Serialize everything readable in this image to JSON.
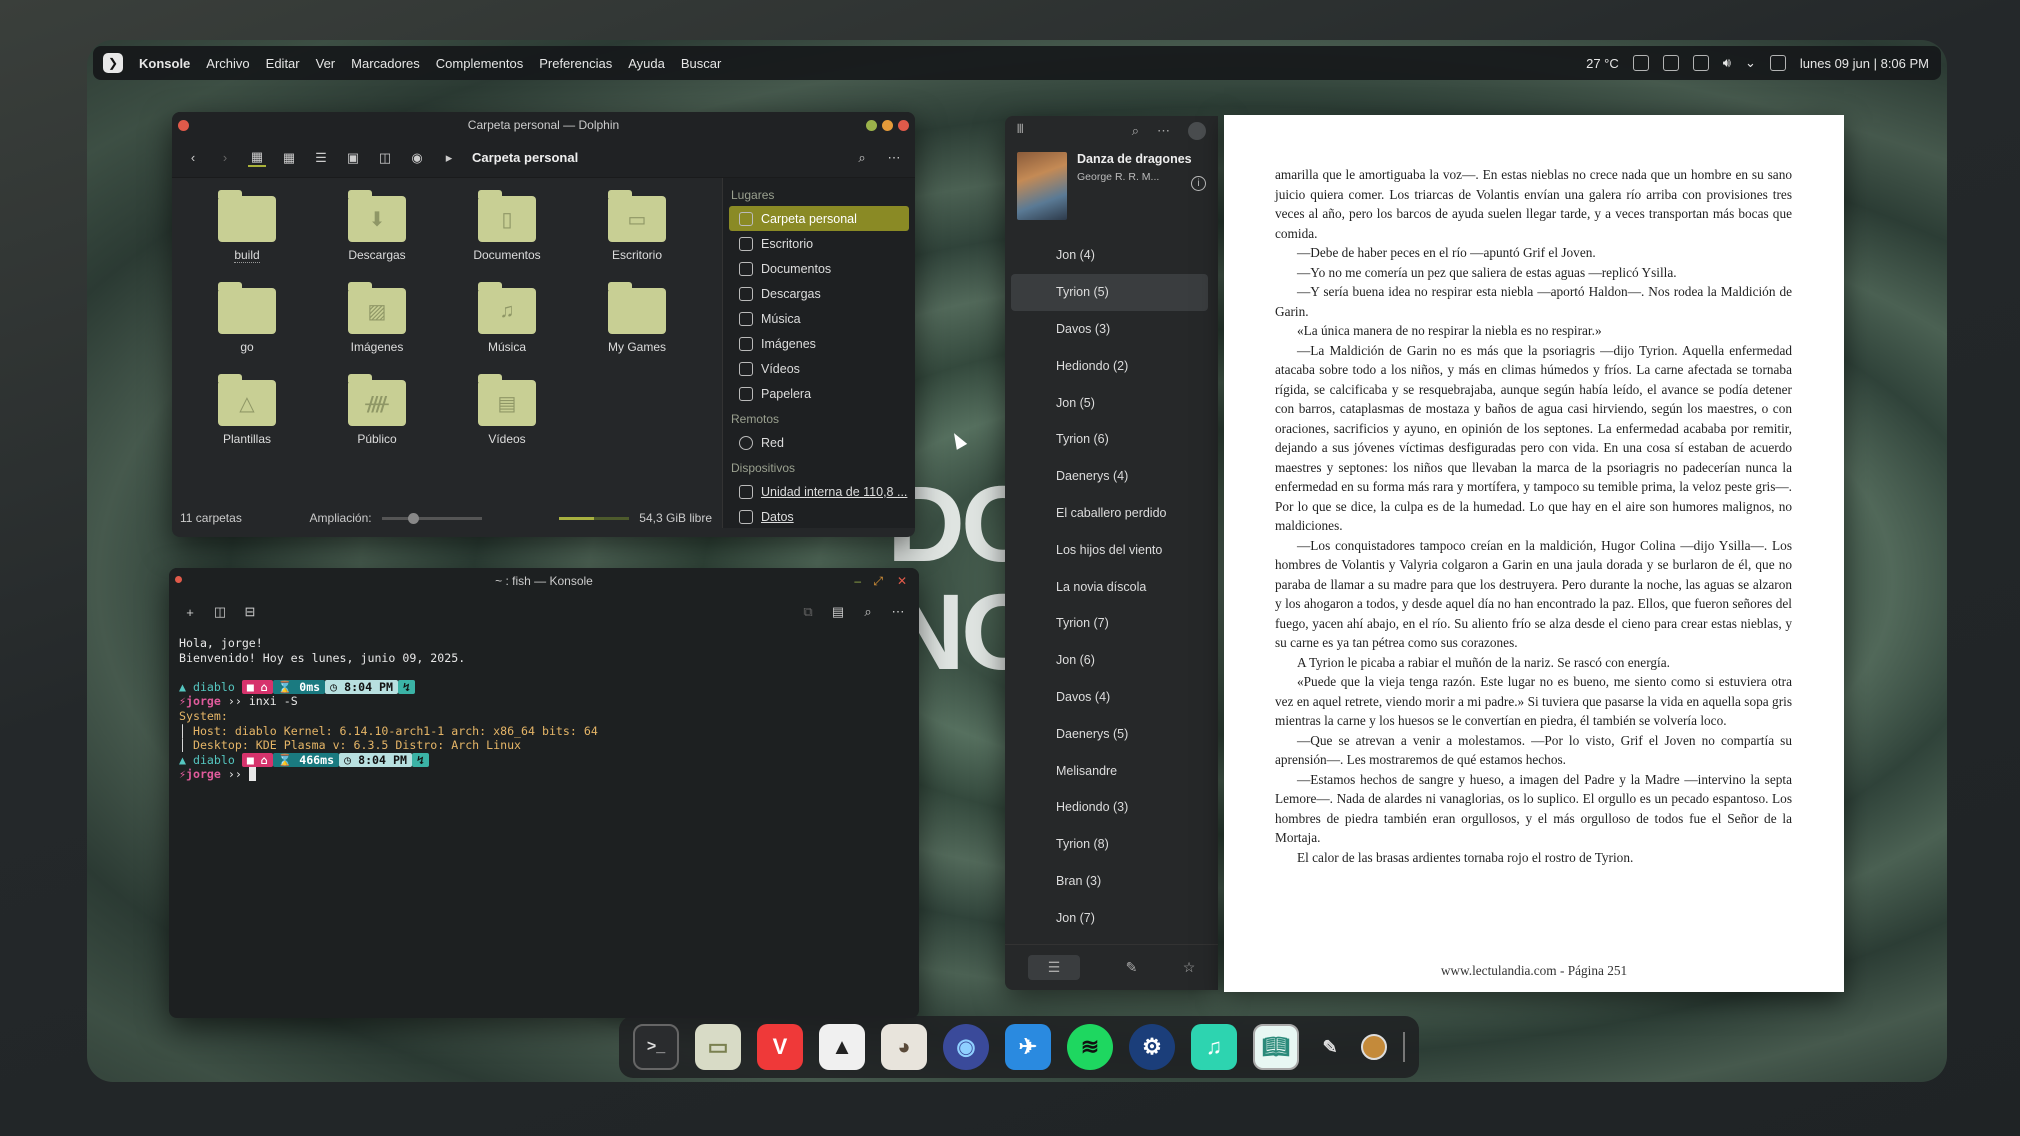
{
  "topbar": {
    "app": "Konsole",
    "menus": [
      "Archivo",
      "Editar",
      "Ver",
      "Marcadores",
      "Complementos",
      "Preferencias",
      "Ayuda",
      "Buscar"
    ],
    "temp": "27 °C",
    "clock": "lunes 09 jun | 8:06 PM"
  },
  "dolphin": {
    "title": "Carpeta personal — Dolphin",
    "breadcrumb": "Carpeta personal",
    "files": [
      {
        "name": "build",
        "icon": "folder"
      },
      {
        "name": "Descargas",
        "icon": "download-folder"
      },
      {
        "name": "Documentos",
        "icon": "document-folder"
      },
      {
        "name": "Escritorio",
        "icon": "desktop-folder"
      },
      {
        "name": "go",
        "icon": "folder"
      },
      {
        "name": "Imágenes",
        "icon": "pictures-folder"
      },
      {
        "name": "Música",
        "icon": "music-folder"
      },
      {
        "name": "My Games",
        "icon": "folder"
      },
      {
        "name": "Plantillas",
        "icon": "templates-folder"
      },
      {
        "name": "Público",
        "icon": "public-folder"
      },
      {
        "name": "Vídeos",
        "icon": "videos-folder"
      }
    ],
    "places_header": "Lugares",
    "places": [
      "Carpeta personal",
      "Escritorio",
      "Documentos",
      "Descargas",
      "Música",
      "Imágenes",
      "Vídeos",
      "Papelera"
    ],
    "remote_header": "Remotos",
    "remote": [
      "Red"
    ],
    "devices_header": "Dispositivos",
    "devices": [
      "Unidad interna de 110,8 ...",
      "Datos"
    ],
    "status_count": "11 carpetas",
    "zoom_label": "Ampliación:",
    "free": "54,3 GiB libre"
  },
  "konsole": {
    "title": "~ : fish — Konsole",
    "greet1": "Hola, jorge!",
    "greet2": "Bienvenido! Hoy es lunes, junio 09, 2025.",
    "host": "diablo",
    "user": "jorge",
    "cmd": "inxi -S",
    "t1": "0ms",
    "time1": "8:04 PM",
    "t2": "466ms",
    "time2": "8:04 PM",
    "sys_label": "System:",
    "line_host": "Host: diablo Kernel: 6.14.10-arch1-1 arch: x86_64 bits: 64",
    "line_desk": "Desktop: KDE Plasma v: 6.3.5 Distro: Arch Linux"
  },
  "reader": {
    "book_title": "Danza de dragones",
    "author": "George R. R. M...",
    "toc": [
      "Jon (4)",
      "Tyrion (5)",
      "Davos (3)",
      "Hediondo (2)",
      "Jon (5)",
      "Tyrion (6)",
      "Daenerys (4)",
      "El caballero perdido",
      "Los hijos del viento",
      "La novia díscola",
      "Tyrion (7)",
      "Jon (6)",
      "Davos (4)",
      "Daenerys (5)",
      "Melisandre",
      "Hediondo (3)",
      "Tyrion (8)",
      "Bran (3)",
      "Jon (7)"
    ],
    "selected": "Tyrion (5)",
    "paragraphs": [
      "amarilla que le amortiguaba la voz—. En estas nieblas no crece nada que un hombre en su sano juicio quiera comer. Los triarcas de Volantis envían una galera río arriba con provisiones tres veces al año, pero los barcos de ayuda suelen llegar tarde, y a veces transportan más bocas que comida.",
      "—Debe de haber peces en el río —apuntó Grif el Joven.",
      "—Yo no me comería un pez que saliera de estas aguas —replicó Ysilla.",
      "—Y sería buena idea no respirar esta niebla —aportó Haldon—. Nos rodea la Maldición de Garin.",
      "«La única manera de no respirar la niebla es no respirar.»",
      "—La Maldición de Garin no es más que la psoriagris —dijo Tyrion. Aquella enfermedad atacaba sobre todo a los niños, y más en climas húmedos y fríos. La carne afectada se tornaba rígida, se calcificaba y se resquebrajaba, aunque según había leído, el avance se podía detener con barros, cataplasmas de mostaza y baños de agua casi hirviendo, según los maestres, o con oraciones, sacrificios y ayuno, en opinión de los septones. La enfermedad acababa por remitir, dejando a sus jóvenes víctimas desfiguradas pero con vida. En una cosa sí estaban de acuerdo maestres y septones: los niños que llevaban la marca de la psoriagris no padecerían nunca la enfermedad en su forma más rara y mortífera, y tampoco su temible prima, la veloz peste gris—. Por lo que se dice, la culpa es de la humedad. Lo que hay en el aire son humores malignos, no maldiciones.",
      "—Los conquistadores tampoco creían en la maldición, Hugor Colina —dijo Ysilla—. Los hombres de Volantis y Valyria colgaron a Garin en una jaula dorada y se burlaron de él, que no paraba de llamar a su madre para que los destruyera. Pero durante la noche, las aguas se alzaron y los ahogaron a todos, y desde aquel día no han encontrado la paz. Ellos, que fueron señores del fuego, yacen ahí abajo, en el río. Su aliento frío se alza desde el cieno para crear estas nieblas, y su carne es ya tan pétrea como sus corazones.",
      "A Tyrion le picaba a rabiar el muñón de la nariz. Se rascó con energía.",
      "«Puede que la vieja tenga razón. Este lugar no es bueno, me siento como si estuviera otra vez en aquel retrete, viendo morir a mi padre.» Si tuviera que pasarse la vida en aquella sopa gris mientras la carne y los huesos se le convertían en piedra, él también se volvería loco.",
      "—Que se atrevan a venir a molestamos. —Por lo visto, Grif el Joven no compartía su aprensión—. Les mostraremos de qué estamos hechos.",
      "—Estamos hechos de sangre y hueso, a imagen del Padre y la Madre —intervino la septa Lemore—. Nada de alardes ni vanaglorias, os lo suplico. El orgullo es un pecado espantoso. Los hombres de piedra también eran orgullosos, y el más orgulloso de todos fue el Señor de la Mortaja.",
      "El calor de las brasas ardientes tornaba rojo el rostro de Tyrion."
    ],
    "footer": "www.lectulandia.com - Página 251"
  },
  "wallpaper_text": [
    "DO",
    "NO"
  ],
  "dock": [
    "terminal-icon",
    "files-icon",
    "vivaldi-icon",
    "inkscape-icon",
    "gimp-icon",
    "browser-icon",
    "swift-icon",
    "spotify-icon",
    "steam-icon",
    "music-icon",
    "book-reader-icon",
    "color-picker-icon",
    "circle-icon"
  ]
}
